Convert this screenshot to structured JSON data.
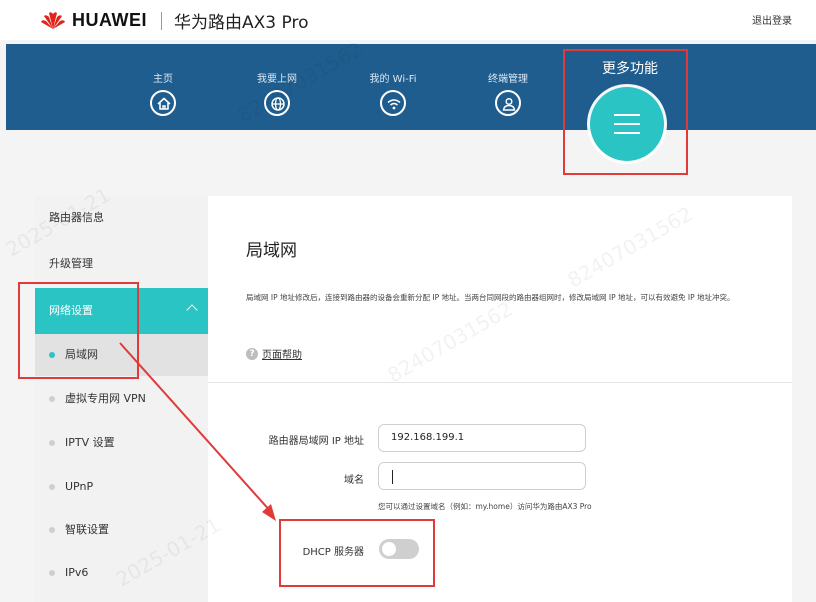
{
  "header": {
    "brand": "HUAWEI",
    "product": "华为路由AX3 Pro",
    "logout": "退出登录"
  },
  "nav": {
    "items": [
      {
        "label": "主页",
        "icon": "home-icon"
      },
      {
        "label": "我要上网",
        "icon": "globe-icon"
      },
      {
        "label": "我的 Wi-Fi",
        "icon": "wifi-icon"
      },
      {
        "label": "终端管理",
        "icon": "user-icon"
      }
    ],
    "more": {
      "label": "更多功能",
      "icon": "menu-icon"
    }
  },
  "sidebar": {
    "items": [
      "路由器信息",
      "升级管理"
    ],
    "group": "网络设置",
    "subitems": [
      {
        "label": "局域网",
        "active": true
      },
      {
        "label": "虚拟专用网 VPN",
        "active": false
      },
      {
        "label": "IPTV 设置",
        "active": false
      },
      {
        "label": "UPnP",
        "active": false
      },
      {
        "label": "智联设置",
        "active": false
      },
      {
        "label": "IPv6",
        "active": false
      }
    ]
  },
  "main": {
    "title": "局域网",
    "description": "局域网 IP 地址修改后，连接到路由器的设备会重新分配 IP 地址。当两台同网段的路由器组网时，修改局域网 IP 地址，可以有效避免 IP 地址冲突。",
    "help_link": "页面帮助",
    "form": {
      "ip_label": "路由器局域网 IP 地址",
      "ip_value": "192.168.199.1",
      "domain_label": "域名",
      "domain_value": "",
      "domain_hint": "您可以通过设置域名（例如：my.home）访问华为路由AX3 Pro",
      "dhcp_label": "DHCP 服务器",
      "dhcp_enabled": false
    }
  },
  "colors": {
    "nav_bg": "#1f5d8e",
    "accent": "#2bc4c4",
    "annotation": "#e03a3a"
  },
  "watermarks": [
    "2025-01-21",
    "82407031562"
  ]
}
